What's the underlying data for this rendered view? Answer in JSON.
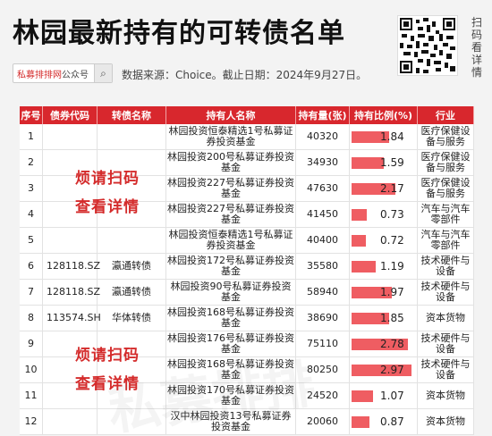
{
  "title": "林园最新持有的可转债名单",
  "search": {
    "brand": "私募排排网",
    "sub": "公众号"
  },
  "source_text": "数据来源：Choice。截止日期：2024年9月27日。",
  "scan_label": "扫码看详情",
  "promo": [
    "烦请扫码",
    "查看详情",
    "烦请扫码",
    "查看详情"
  ],
  "columns": [
    "序号",
    "债券代码",
    "转债名称",
    "持有人名称",
    "持有量(张)",
    "持有比例(%)",
    "行业"
  ],
  "rows": [
    {
      "no": "1",
      "code": "",
      "name": "",
      "holder": "林园投资恒泰精选1号私募证券投资基金",
      "qty": "40320",
      "pct": "1.84",
      "pct_val": 1.84,
      "industry": "医疗保健设备与服务"
    },
    {
      "no": "2",
      "code": "",
      "name": "",
      "holder": "林园投资200号私募证券投资基金",
      "qty": "34930",
      "pct": "1.59",
      "pct_val": 1.59,
      "industry": "医疗保健设备与服务"
    },
    {
      "no": "3",
      "code": "",
      "name": "",
      "holder": "林园投资227号私募证券投资基金",
      "qty": "47630",
      "pct": "2.17",
      "pct_val": 2.17,
      "industry": "医疗保健设备与服务"
    },
    {
      "no": "4",
      "code": "",
      "name": "",
      "holder": "林园投资227号私募证券投资基金",
      "qty": "41450",
      "pct": "0.73",
      "pct_val": 0.73,
      "industry": "汽车与汽车零部件"
    },
    {
      "no": "5",
      "code": "",
      "name": "",
      "holder": "林园投资恒泰精选1号私募证券投资基金",
      "qty": "40400",
      "pct": "0.72",
      "pct_val": 0.72,
      "industry": "汽车与汽车零部件"
    },
    {
      "no": "6",
      "code": "128118.SZ",
      "name": "瀛通转债",
      "holder": "林园投资172号私募证券投资基金",
      "qty": "35580",
      "pct": "1.19",
      "pct_val": 1.19,
      "industry": "技术硬件与设备"
    },
    {
      "no": "7",
      "code": "128118.SZ",
      "name": "瀛通转债",
      "holder": "林园投资90号私募证券投资基金",
      "qty": "58940",
      "pct": "1.97",
      "pct_val": 1.97,
      "industry": "技术硬件与设备"
    },
    {
      "no": "8",
      "code": "113574.SH",
      "name": "华体转债",
      "holder": "林园投资168号私募证券投资基金",
      "qty": "38690",
      "pct": "1.85",
      "pct_val": 1.85,
      "industry": "资本货物"
    },
    {
      "no": "9",
      "code": "",
      "name": "",
      "holder": "林园投资176号私募证券投资基金",
      "qty": "75110",
      "pct": "2.78",
      "pct_val": 2.78,
      "industry": "技术硬件与设备"
    },
    {
      "no": "10",
      "code": "",
      "name": "",
      "holder": "林园投资168号私募证券投资基金",
      "qty": "80250",
      "pct": "2.97",
      "pct_val": 2.97,
      "industry": "技术硬件与设备"
    },
    {
      "no": "11",
      "code": "",
      "name": "",
      "holder": "林园投资170号私募证券投资基金",
      "qty": "24520",
      "pct": "1.07",
      "pct_val": 1.07,
      "industry": "资本货物"
    },
    {
      "no": "12",
      "code": "",
      "name": "",
      "holder": "汉中林园投资13号私募证券投资基金",
      "qty": "20060",
      "pct": "0.87",
      "pct_val": 0.87,
      "industry": "资本货物"
    }
  ],
  "colors": {
    "accent": "#d8272d",
    "bar": "#ef5d62"
  }
}
